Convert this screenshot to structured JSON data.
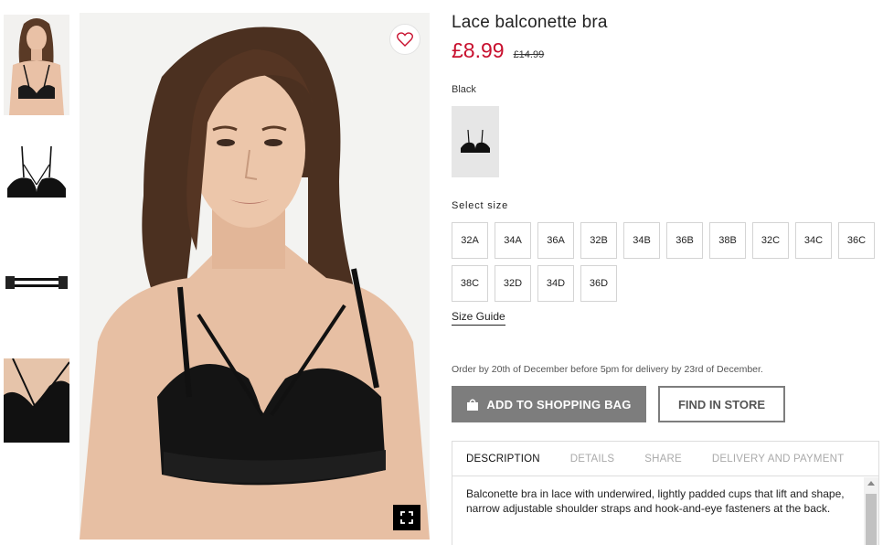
{
  "product": {
    "title": "Lace balconette bra",
    "price": "£8.99",
    "old_price": "£14.99"
  },
  "color": {
    "label": "Black"
  },
  "size_section": {
    "label": "Select size",
    "sizes": [
      "32A",
      "34A",
      "36A",
      "32B",
      "34B",
      "36B",
      "38B",
      "32C",
      "34C",
      "36C",
      "38C",
      "32D",
      "34D",
      "36D"
    ],
    "guide_label": "Size Guide"
  },
  "delivery_note": "Order by 20th of December before 5pm for delivery by 23rd of December.",
  "actions": {
    "add_to_bag": "ADD TO SHOPPING BAG",
    "find_in_store": "FIND IN STORE"
  },
  "tabs": {
    "items": [
      "DESCRIPTION",
      "DETAILS",
      "SHARE",
      "DELIVERY AND PAYMENT"
    ],
    "active": "DESCRIPTION",
    "description": "Balconette bra in lace with underwired, lightly padded cups that lift and shape, narrow adjustable shoulder straps and hook-and-eye fasteners at the back."
  },
  "icons": {
    "favorite": "heart-icon",
    "expand": "expand-icon",
    "bag": "shopping-bag-icon"
  },
  "colors": {
    "price_red": "#c8102e",
    "button_gray": "#7d7d7d"
  }
}
